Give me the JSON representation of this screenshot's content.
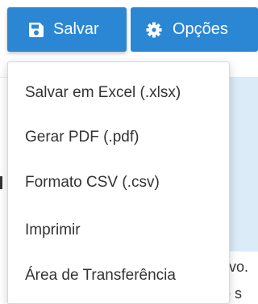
{
  "toolbar": {
    "save_label": "Salvar",
    "save_icon": "floppy-disk-icon",
    "options_label": "Opções",
    "options_icon": "gear-icon",
    "button_color": "#2b87d4"
  },
  "dropdown": {
    "items": [
      {
        "label": "Salvar em Excel (.xlsx)"
      },
      {
        "label": "Gerar PDF (.pdf)"
      },
      {
        "label": "Formato CSV (.csv)"
      },
      {
        "label": "Imprimir"
      },
      {
        "label": "Área de Transferência"
      }
    ]
  },
  "background": {
    "text_fragment_1": "vo.",
    "text_fragment_2": "o s"
  }
}
